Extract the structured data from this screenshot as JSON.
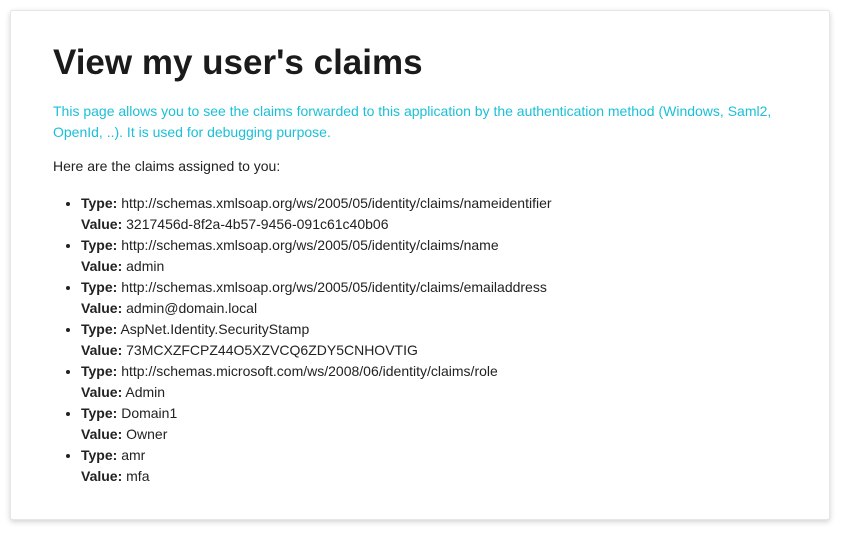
{
  "page": {
    "title": "View my user's claims",
    "description": "This page allows you to see the claims forwarded to this application by the authentication method (Windows, Saml2, OpenId, ..). It is used for debugging purpose.",
    "intro": "Here are the claims assigned to you:",
    "type_label": "Type:",
    "value_label": "Value:",
    "accent_color": "#1bc0d8"
  },
  "claims": [
    {
      "type": "http://schemas.xmlsoap.org/ws/2005/05/identity/claims/nameidentifier",
      "value": "3217456d-8f2a-4b57-9456-091c61c40b06"
    },
    {
      "type": "http://schemas.xmlsoap.org/ws/2005/05/identity/claims/name",
      "value": "admin"
    },
    {
      "type": "http://schemas.xmlsoap.org/ws/2005/05/identity/claims/emailaddress",
      "value": "admin@domain.local"
    },
    {
      "type": "AspNet.Identity.SecurityStamp",
      "value": "73MCXZFCPZ44O5XZVCQ6ZDY5CNHOVTIG"
    },
    {
      "type": "http://schemas.microsoft.com/ws/2008/06/identity/claims/role",
      "value": "Admin"
    },
    {
      "type": "Domain1",
      "value": "Owner"
    },
    {
      "type": "amr",
      "value": "mfa"
    }
  ]
}
